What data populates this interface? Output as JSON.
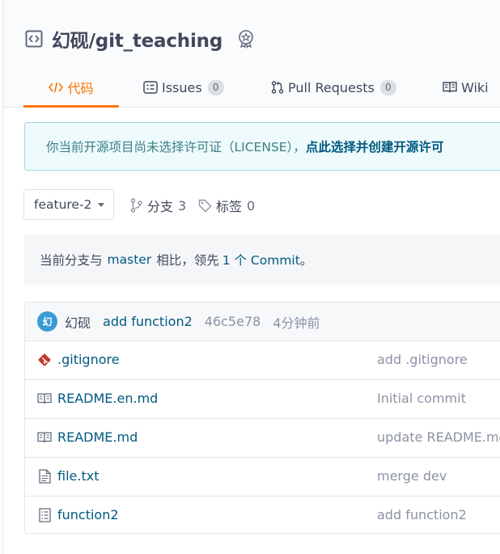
{
  "repo": {
    "title": "幻砚/git_teaching"
  },
  "tabs": [
    {
      "label": "代码",
      "active": true
    },
    {
      "label": "Issues",
      "count": "0"
    },
    {
      "label": "Pull Requests",
      "count": "0"
    },
    {
      "label": "Wiki"
    }
  ],
  "notice": {
    "text": "你当前开源项目尚未选择许可证（LICENSE），",
    "link": "点此选择并创建开源许可"
  },
  "branch_bar": {
    "current_branch": "feature-2",
    "branches_label": "分支",
    "branches_count": "3",
    "tags_label": "标签",
    "tags_count": "0"
  },
  "compare": {
    "prefix": "当前分支与",
    "base": "master",
    "middle": "相比，领先",
    "ahead": "1 个 Commit",
    "suffix": "。"
  },
  "last_commit": {
    "avatar_text": "幻",
    "author": "幻砚",
    "message": "add function2",
    "sha": "46c5e78",
    "time": "4分钟前"
  },
  "files": [
    {
      "name": ".gitignore",
      "commit": "add .gitignore",
      "icon": "git-icon"
    },
    {
      "name": "README.en.md",
      "commit": "Initial commit",
      "icon": "book-icon"
    },
    {
      "name": "README.md",
      "commit": "update README.md",
      "icon": "book-icon"
    },
    {
      "name": "file.txt",
      "commit": "merge dev",
      "icon": "file-text-icon"
    },
    {
      "name": "function2",
      "commit": "add function2",
      "icon": "file-list-icon"
    }
  ],
  "colors": {
    "accent": "#fe7300",
    "link": "#005980",
    "avatar": "#3a9bd5",
    "git": "#c0392b"
  }
}
